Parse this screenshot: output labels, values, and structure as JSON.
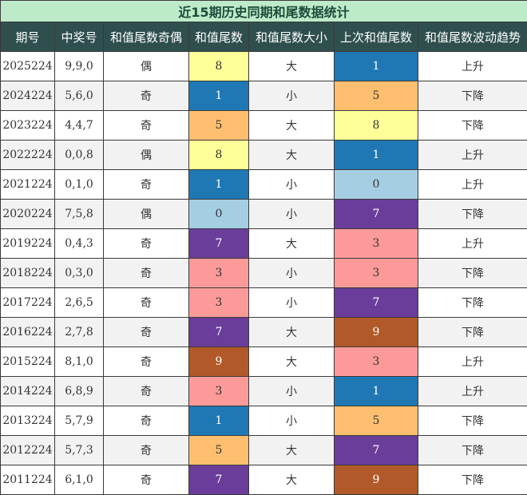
{
  "title": "近15期历史同期和尾数据统计",
  "headers": [
    "期号",
    "中奖号",
    "和值尾数奇偶",
    "和值尾数",
    "和值尾数大小",
    "上次和值尾数",
    "和值尾数波动趋势"
  ],
  "digit_colors": {
    "0": "#a6cee3",
    "1": "#1f78b4",
    "3": "#fb9a99",
    "5": "#fdbf6f",
    "7": "#6a3d9a",
    "8": "#ffff99",
    "9": "#b15928"
  },
  "rows": [
    {
      "issue": "2025224",
      "numbers": "9,9,0",
      "parity": "偶",
      "tail": "8",
      "size": "大",
      "prev_tail": "1",
      "trend": "上升"
    },
    {
      "issue": "2024224",
      "numbers": "5,6,0",
      "parity": "奇",
      "tail": "1",
      "size": "小",
      "prev_tail": "5",
      "trend": "下降"
    },
    {
      "issue": "2023224",
      "numbers": "4,4,7",
      "parity": "奇",
      "tail": "5",
      "size": "大",
      "prev_tail": "8",
      "trend": "下降"
    },
    {
      "issue": "2022224",
      "numbers": "0,0,8",
      "parity": "偶",
      "tail": "8",
      "size": "大",
      "prev_tail": "1",
      "trend": "上升"
    },
    {
      "issue": "2021224",
      "numbers": "0,1,0",
      "parity": "奇",
      "tail": "1",
      "size": "小",
      "prev_tail": "0",
      "trend": "上升"
    },
    {
      "issue": "2020224",
      "numbers": "7,5,8",
      "parity": "偶",
      "tail": "0",
      "size": "小",
      "prev_tail": "7",
      "trend": "下降"
    },
    {
      "issue": "2019224",
      "numbers": "0,4,3",
      "parity": "奇",
      "tail": "7",
      "size": "大",
      "prev_tail": "3",
      "trend": "上升"
    },
    {
      "issue": "2018224",
      "numbers": "0,3,0",
      "parity": "奇",
      "tail": "3",
      "size": "小",
      "prev_tail": "3",
      "trend": "下降"
    },
    {
      "issue": "2017224",
      "numbers": "2,6,5",
      "parity": "奇",
      "tail": "3",
      "size": "小",
      "prev_tail": "7",
      "trend": "下降"
    },
    {
      "issue": "2016224",
      "numbers": "2,7,8",
      "parity": "奇",
      "tail": "7",
      "size": "大",
      "prev_tail": "9",
      "trend": "下降"
    },
    {
      "issue": "2015224",
      "numbers": "8,1,0",
      "parity": "奇",
      "tail": "9",
      "size": "大",
      "prev_tail": "3",
      "trend": "上升"
    },
    {
      "issue": "2014224",
      "numbers": "6,8,9",
      "parity": "奇",
      "tail": "3",
      "size": "小",
      "prev_tail": "1",
      "trend": "上升"
    },
    {
      "issue": "2013224",
      "numbers": "5,7,9",
      "parity": "奇",
      "tail": "1",
      "size": "小",
      "prev_tail": "5",
      "trend": "下降"
    },
    {
      "issue": "2012224",
      "numbers": "5,7,3",
      "parity": "奇",
      "tail": "5",
      "size": "大",
      "prev_tail": "7",
      "trend": "下降"
    },
    {
      "issue": "2011224",
      "numbers": "6,1,0",
      "parity": "奇",
      "tail": "7",
      "size": "大",
      "prev_tail": "9",
      "trend": "下降"
    }
  ]
}
